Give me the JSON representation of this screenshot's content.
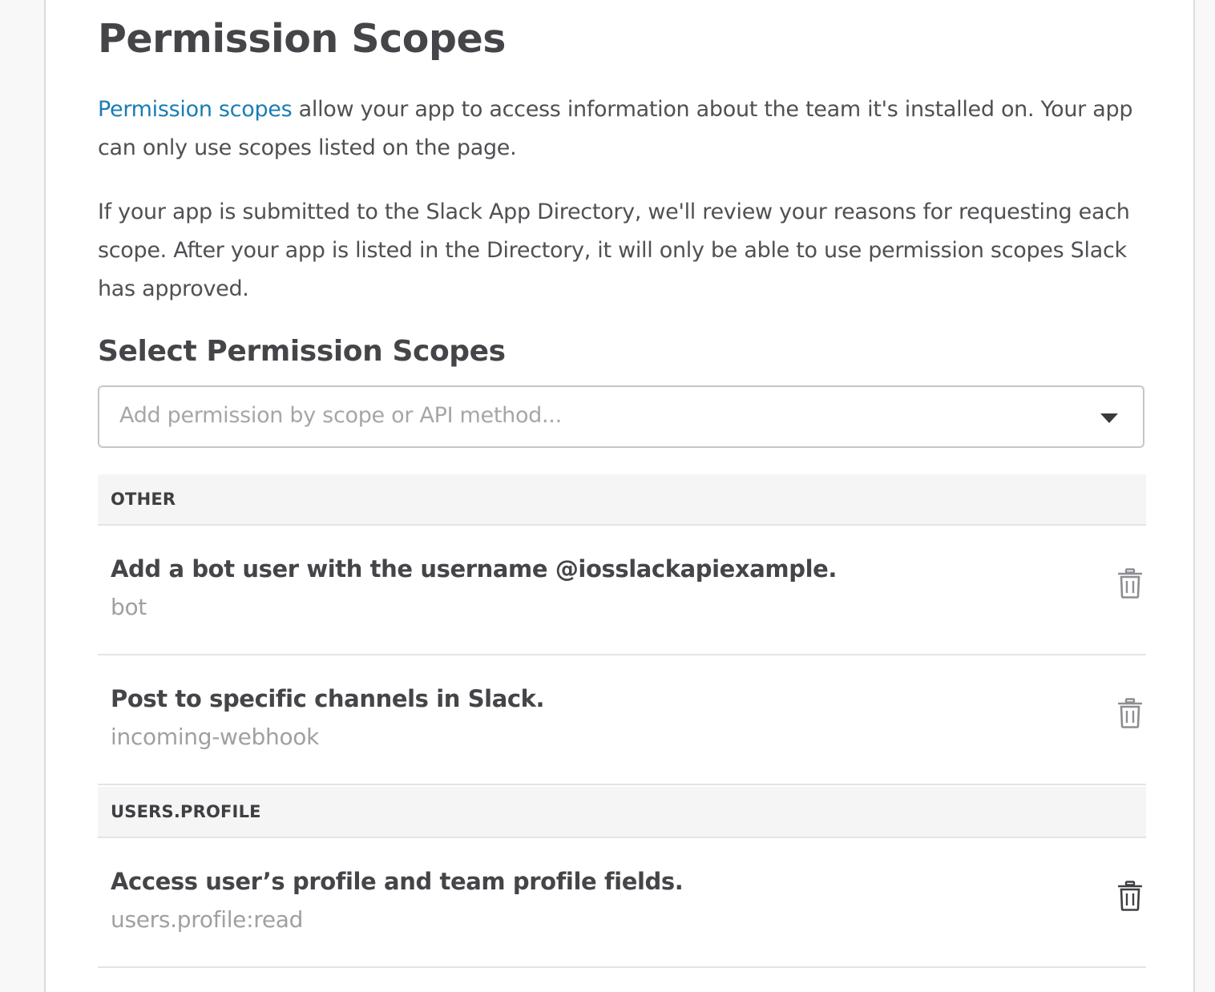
{
  "page": {
    "title": "Permission Scopes",
    "intro_link": "Permission scopes",
    "intro_rest": " allow your app to access information about the team it's installed on. Your app can only use scopes listed on the page.",
    "review_text": "If your app is submitted to the Slack App Directory, we'll review your reasons for requesting each scope. After your app is listed in the Directory, it will only be able to use permission scopes Slack has approved."
  },
  "select": {
    "heading": "Select Permission Scopes",
    "placeholder": "Add permission by scope or API method..."
  },
  "groups": [
    {
      "label": "OTHER",
      "items": [
        {
          "title": "Add a bot user with the username @iosslackapiexample.",
          "scope": "bot",
          "icon": "trash-icon"
        },
        {
          "title": "Post to specific channels in Slack.",
          "scope": "incoming-webhook",
          "icon": "trash-icon"
        }
      ]
    },
    {
      "label": "USERS.PROFILE",
      "items": [
        {
          "title": "Access user’s profile and team profile fields.",
          "scope": "users.profile:read",
          "icon": "trash-icon"
        }
      ]
    }
  ],
  "colors": {
    "link": "#1a7db3",
    "text": "#4a4a4f",
    "muted": "#a0a0a4",
    "section_bg": "#f5f5f6"
  }
}
